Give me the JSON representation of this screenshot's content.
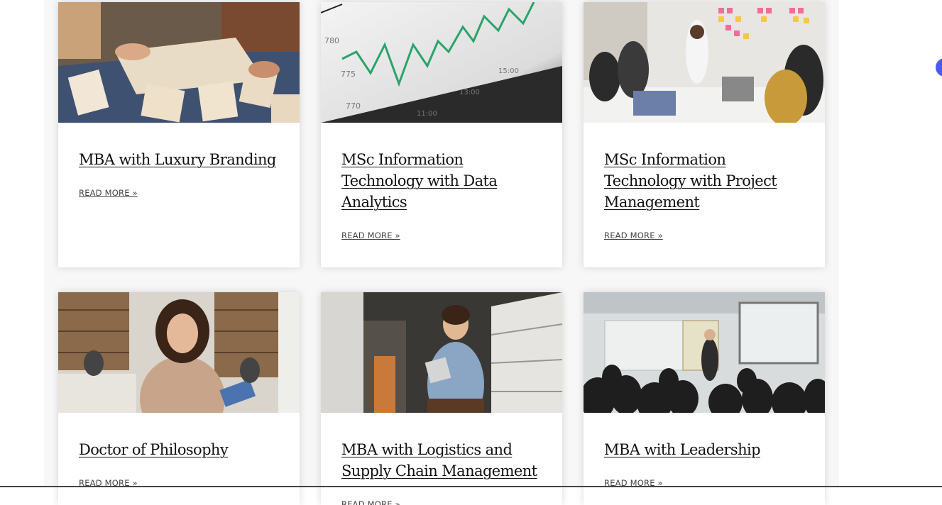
{
  "cards": [
    {
      "title": "MBA with Luxury Branding",
      "read_more": "READ MORE »",
      "image": "fashion-design-table-photo"
    },
    {
      "title": "MSc Information Technology with Data Analytics",
      "read_more": "READ MORE »",
      "image": "stock-chart-screen-photo"
    },
    {
      "title": "MSc Information Technology with Project Management",
      "read_more": "READ MORE »",
      "image": "team-sticky-notes-meeting-photo"
    },
    {
      "title": "Doctor of Philosophy",
      "read_more": "READ MORE »",
      "image": "student-in-library-photo"
    },
    {
      "title": "MBA with Logistics and Supply Chain Management",
      "read_more": "READ MORE »",
      "image": "warehouse-worker-tablet-photo"
    },
    {
      "title": "MBA with Leadership",
      "read_more": "READ MORE »",
      "image": "classroom-presentation-photo"
    }
  ],
  "chat_widget": {
    "icon": "chat-bubble-icon",
    "color": "#4a5cf0"
  }
}
